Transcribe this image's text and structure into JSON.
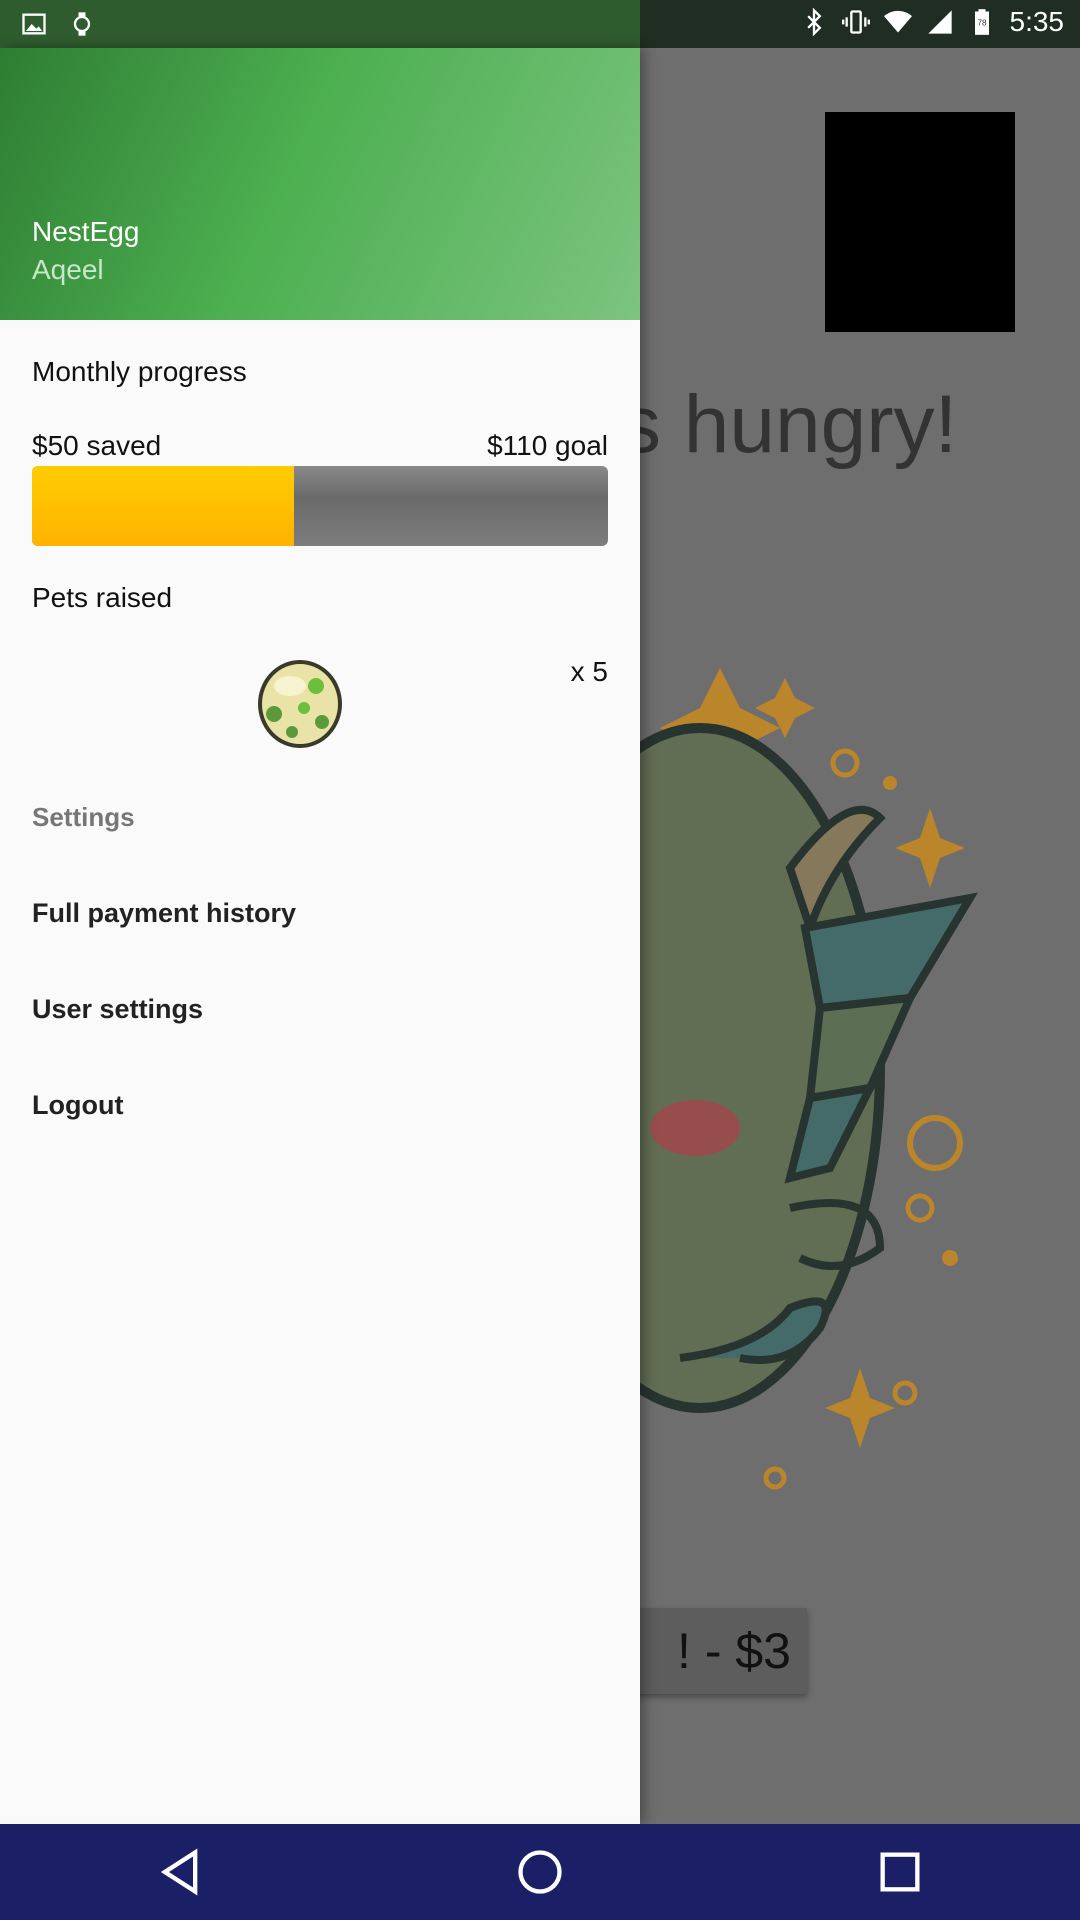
{
  "status_bar": {
    "time": "5:35",
    "battery_level": "78",
    "left_icons": [
      "image-icon",
      "watch-icon"
    ],
    "right_icons": [
      "bluetooth-icon",
      "vibrate-icon",
      "wifi-icon",
      "signal-icon",
      "battery-icon"
    ]
  },
  "background_app": {
    "hungry_text": "s hungry!",
    "feed_button_label": "! - $3"
  },
  "drawer": {
    "header": {
      "app_name": "NestEgg",
      "user_name": "Aqeel"
    },
    "monthly_progress": {
      "title": "Monthly progress",
      "saved_label": "$50 saved",
      "goal_label": "$110 goal",
      "saved_value": 50,
      "goal_value": 110
    },
    "pets": {
      "title": "Pets raised",
      "count_label": "x 5"
    },
    "settings": {
      "heading": "Settings",
      "items": [
        {
          "label": "Full payment history"
        },
        {
          "label": "User settings"
        },
        {
          "label": "Logout"
        }
      ]
    }
  },
  "colors": {
    "header_start": "#2e7d32",
    "header_end": "#7cc47f",
    "progress_fill": "#ffb300",
    "nav_bar": "#1b2066"
  },
  "nav_bar": {
    "icons": [
      "back-icon",
      "home-icon",
      "recents-icon"
    ]
  }
}
